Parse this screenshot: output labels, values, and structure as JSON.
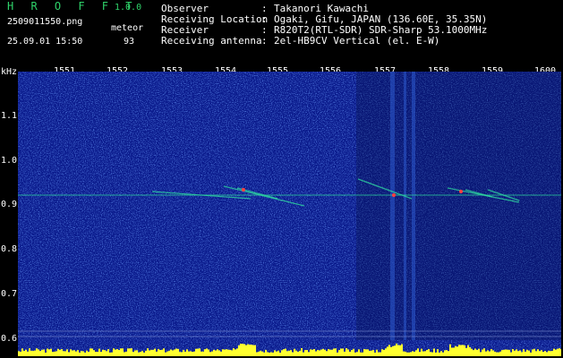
{
  "header": {
    "app_title": "H R O F F T",
    "app_version": "1.0.0",
    "filename": "2509011550.png",
    "meteor_label": "meteor",
    "datetime": "25.09.01 15:50",
    "meteor_count": "93",
    "info": [
      {
        "label": "Observer",
        "value": "Takanori Kawachi"
      },
      {
        "label": "Receiving Location",
        "value": "Ogaki, Gifu, JAPAN (136.60E, 35.35N)"
      },
      {
        "label": "Receiver",
        "value": "R820T2(RTL-SDR) SDR-Sharp 53.1000MHz"
      },
      {
        "label": "Receiving antenna",
        "value": "2el-HB9CV Vertical (el. E-W)"
      }
    ]
  },
  "axis": {
    "y_unit": "kHz",
    "x_ticks": [
      "1551",
      "1552",
      "1553",
      "1554",
      "1555",
      "1556",
      "1557",
      "1558",
      "1559",
      "1600"
    ],
    "y_ticks": [
      "1.1",
      "1.0",
      "0.9",
      "0.8",
      "0.7",
      "0.6"
    ]
  },
  "colors": {
    "background": "#0a1a8c",
    "noise_bright": "#5aa0ff",
    "signal": "#2ee0a0",
    "meteor": "#ff4040",
    "activity": "#ffff30",
    "baseline": "#00e0ff"
  }
}
